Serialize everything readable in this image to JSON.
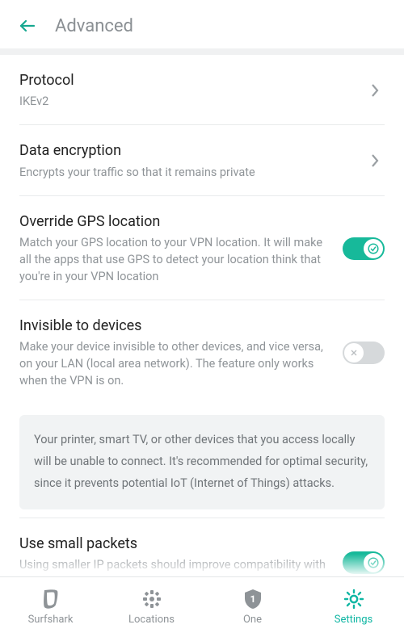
{
  "header": {
    "title": "Advanced"
  },
  "items": {
    "protocol": {
      "title": "Protocol",
      "subtitle": "IKEv2"
    },
    "encryption": {
      "title": "Data encryption",
      "subtitle": "Encrypts your traffic so that it remains private"
    },
    "gps": {
      "title": "Override GPS location",
      "subtitle": "Match your GPS location to your VPN location. It will make all the apps that use GPS to detect your location think that you're in your VPN location"
    },
    "invisible": {
      "title": "Invisible to devices",
      "subtitle": "Make your device invisible to other devices, and vice versa, on your LAN (local area network). The feature only works when the VPN is on."
    },
    "invisible_info": "Your printer, smart TV, or other devices that you access locally will be unable to connect. It's recommended for optimal security, since it prevents potential IoT (Internet of Things) attacks.",
    "packets": {
      "title": "Use small packets",
      "subtitle": "Using smaller IP packets should improve compatibility with some routers and mobile"
    }
  },
  "toggles": {
    "gps": true,
    "invisible": false,
    "packets": true
  },
  "tabs": {
    "surfshark": "Surfshark",
    "locations": "Locations",
    "one": "One",
    "settings": "Settings"
  },
  "colors": {
    "accent": "#17b99a",
    "muted": "#8e9397"
  }
}
